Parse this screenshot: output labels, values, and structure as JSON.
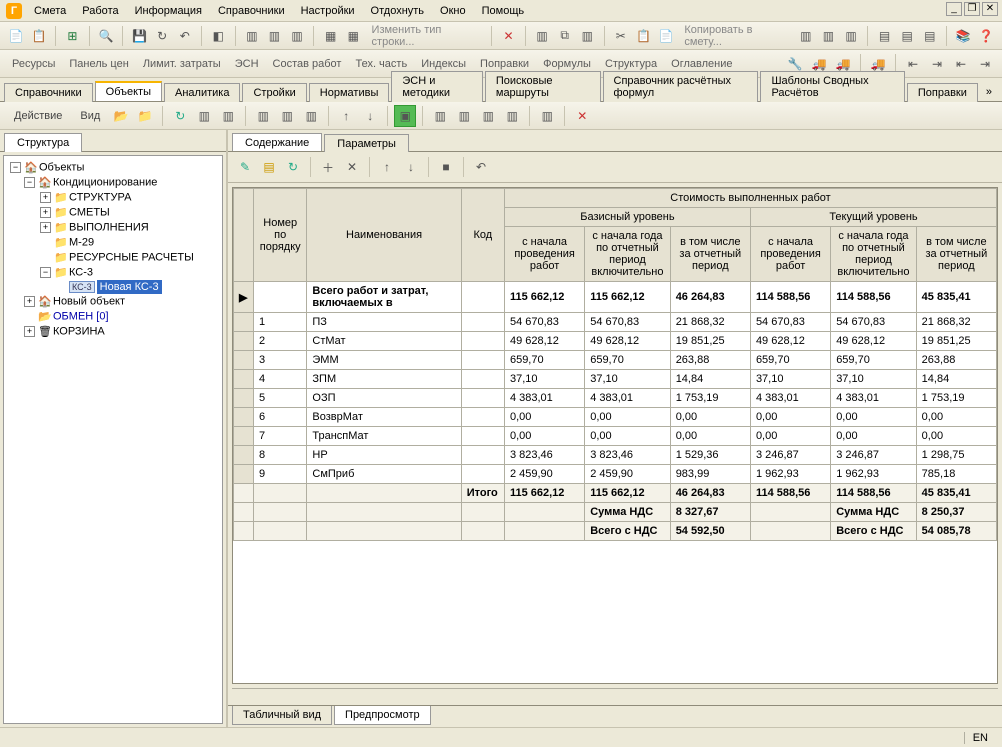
{
  "menu": [
    "Смета",
    "Работа",
    "Информация",
    "Справочники",
    "Настройки",
    "Отдохнуть",
    "Окно",
    "Помощь"
  ],
  "toolbar1": {
    "change_row_type": "Изменить тип строки...",
    "copy_to_estimate": "Копировать в смету..."
  },
  "linkbar": [
    "Ресурсы",
    "Панель цен",
    "Лимит. затраты",
    "ЭСН",
    "Состав работ",
    "Тех. часть",
    "Индексы",
    "Поправки",
    "Формулы",
    "Структура",
    "Оглавление"
  ],
  "maintabs": [
    "Справочники",
    "Объекты",
    "Аналитика",
    "Стройки",
    "Нормативы",
    "ЭСН и методики",
    "Поисковые маршруты",
    "Справочник расчётных формул",
    "Шаблоны Сводных Расчётов",
    "Поправки"
  ],
  "maintabs_active": 1,
  "actionbar": {
    "action": "Действие",
    "view": "Вид"
  },
  "leftpanel_tab": "Структура",
  "tree": {
    "root": "Объекты",
    "n1": "Кондиционирование",
    "n1_1": "СТРУКТУРА",
    "n1_2": "СМЕТЫ",
    "n1_3": "ВЫПОЛНЕНИЯ",
    "n1_4": "М-29",
    "n1_5": "РЕСУРСНЫЕ РАСЧЕТЫ",
    "n1_6": "КС-3",
    "n1_6_1": "Новая КС-3",
    "kc3_badge": "КС-3",
    "n2": "Новый объект",
    "n3_label": "ОБМЕН  [0]",
    "n4": "КОРЗИНА"
  },
  "rp_tabs": [
    "Содержание",
    "Параметры"
  ],
  "rp_tabs_active": 0,
  "grid": {
    "header_top": "Стоимость выполненных работ",
    "header_num": "Номер по порядку",
    "header_name": "Наименования",
    "header_code": "Код",
    "header_base": "Базисный уровень",
    "header_current": "Текущий уровень",
    "col_a": "с начала проведения работ",
    "col_b": "с начала года по отчетный период включительно",
    "col_c": "в том числе за отчетный период",
    "total_label": "Всего работ и затрат, включаемых в",
    "total": [
      "115 662,12",
      "115 662,12",
      "46 264,83",
      "114 588,56",
      "114 588,56",
      "45 835,41"
    ],
    "rows": [
      {
        "n": "1",
        "name": "ПЗ",
        "v": [
          "54 670,83",
          "54 670,83",
          "21 868,32",
          "54 670,83",
          "54 670,83",
          "21 868,32"
        ]
      },
      {
        "n": "2",
        "name": "СтМат",
        "v": [
          "49 628,12",
          "49 628,12",
          "19 851,25",
          "49 628,12",
          "49 628,12",
          "19 851,25"
        ]
      },
      {
        "n": "3",
        "name": "ЭММ",
        "v": [
          "659,70",
          "659,70",
          "263,88",
          "659,70",
          "659,70",
          "263,88"
        ]
      },
      {
        "n": "4",
        "name": "ЗПМ",
        "v": [
          "37,10",
          "37,10",
          "14,84",
          "37,10",
          "37,10",
          "14,84"
        ]
      },
      {
        "n": "5",
        "name": "ОЗП",
        "v": [
          "4 383,01",
          "4 383,01",
          "1 753,19",
          "4 383,01",
          "4 383,01",
          "1 753,19"
        ]
      },
      {
        "n": "6",
        "name": "ВозврМат",
        "v": [
          "0,00",
          "0,00",
          "0,00",
          "0,00",
          "0,00",
          "0,00"
        ]
      },
      {
        "n": "7",
        "name": "ТранспМат",
        "v": [
          "0,00",
          "0,00",
          "0,00",
          "0,00",
          "0,00",
          "0,00"
        ]
      },
      {
        "n": "8",
        "name": "НР",
        "v": [
          "3 823,46",
          "3 823,46",
          "1 529,36",
          "3 246,87",
          "3 246,87",
          "1 298,75"
        ]
      },
      {
        "n": "9",
        "name": "СмПриб",
        "v": [
          "2 459,90",
          "2 459,90",
          "983,99",
          "1 962,93",
          "1 962,93",
          "785,18"
        ]
      }
    ],
    "itogo_label": "Итого",
    "itogo": [
      "115 662,12",
      "115 662,12",
      "46 264,83",
      "114 588,56",
      "114 588,56",
      "45 835,41"
    ],
    "nds_label": "Сумма НДС",
    "nds": [
      "8 327,67",
      "8 250,37"
    ],
    "withnds_label": "Всего с НДС",
    "withnds": [
      "54 592,50",
      "54 085,78"
    ]
  },
  "bottom_tabs": [
    "Табличный вид",
    "Предпросмотр"
  ],
  "bottom_tabs_active": 1,
  "status": {
    "lang": "EN"
  }
}
